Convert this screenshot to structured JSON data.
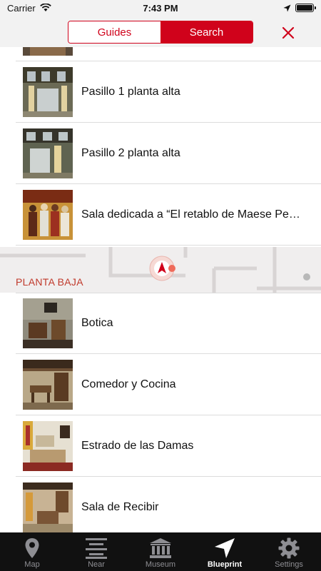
{
  "status_bar": {
    "carrier": "Carrier",
    "time": "7:43 PM",
    "battery_level": 1.0
  },
  "header": {
    "segments": [
      {
        "label": "Guides",
        "active": false
      },
      {
        "label": "Search",
        "active": true
      }
    ],
    "close_icon": "close-icon"
  },
  "list": {
    "upper_items": [
      {
        "label": "Pasillo 1 planta alta"
      },
      {
        "label": "Pasillo 2 planta alta"
      },
      {
        "label": "Sala dedicada a “El retablo de Maese Pe…"
      }
    ],
    "section_title": "PLANTA BAJA",
    "lower_items": [
      {
        "label": "Botica"
      },
      {
        "label": "Comedor y Cocina"
      },
      {
        "label": "Estrado de las Damas"
      },
      {
        "label": "Sala de Recibir"
      }
    ]
  },
  "tab_bar": {
    "tabs": [
      {
        "label": "Map",
        "icon": "map-pin-icon",
        "active": false
      },
      {
        "label": "Near",
        "icon": "list-icon",
        "active": false
      },
      {
        "label": "Museum",
        "icon": "museum-icon",
        "active": false
      },
      {
        "label": "Blueprint",
        "icon": "navigation-arrow-icon",
        "active": true
      },
      {
        "label": "Settings",
        "icon": "gear-icon",
        "active": false
      }
    ]
  },
  "colors": {
    "accent": "#d0021b",
    "section_header": "#c0392b",
    "tab_bar_bg": "#111111"
  }
}
